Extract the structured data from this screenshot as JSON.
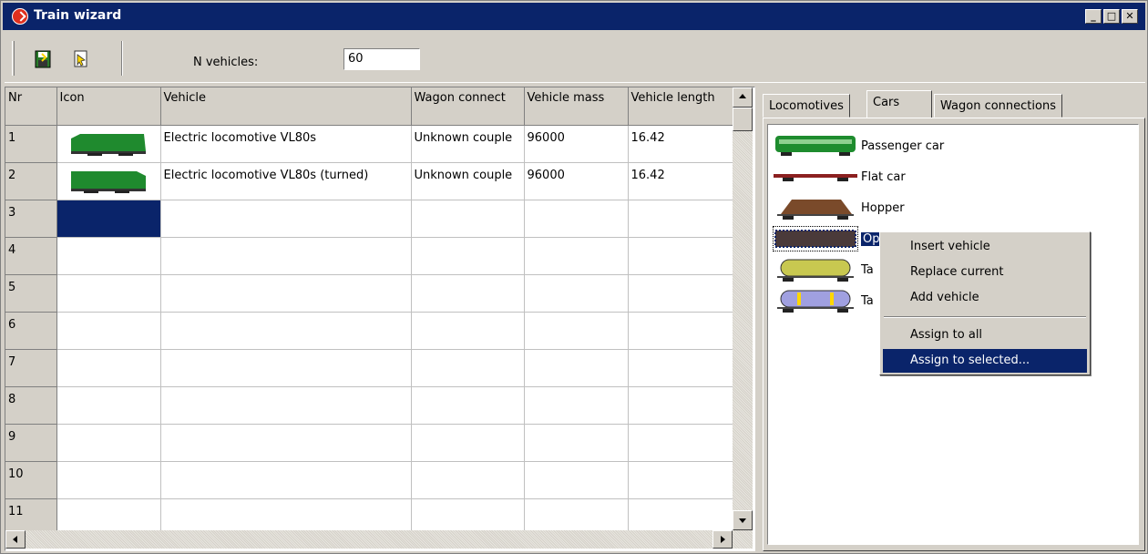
{
  "window": {
    "title": "Train wizard",
    "controls": [
      "_",
      "□",
      "✕"
    ]
  },
  "toolbar": {
    "save_icon": "save-icon",
    "select_icon": "select-icon",
    "n_vehicles_label": "N vehicles:",
    "n_vehicles_value": "60"
  },
  "grid": {
    "headers": [
      "Nr",
      "Icon",
      "Vehicle",
      "Wagon connect",
      "Vehicle mass",
      "Vehicle length"
    ],
    "rows": [
      {
        "nr": "1",
        "vehicle": "Electric locomotive VL80s",
        "connection": "Unknown couple",
        "mass": "96000",
        "length": "16.42"
      },
      {
        "nr": "2",
        "vehicle": "Electric locomotive VL80s (turned)",
        "connection": "Unknown couple",
        "mass": "96000",
        "length": "16.42"
      },
      {
        "nr": "3",
        "vehicle": "",
        "connection": "",
        "mass": "",
        "length": ""
      },
      {
        "nr": "4",
        "vehicle": "",
        "connection": "",
        "mass": "",
        "length": ""
      },
      {
        "nr": "5",
        "vehicle": "",
        "connection": "",
        "mass": "",
        "length": ""
      },
      {
        "nr": "6",
        "vehicle": "",
        "connection": "",
        "mass": "",
        "length": ""
      },
      {
        "nr": "7",
        "vehicle": "",
        "connection": "",
        "mass": "",
        "length": ""
      },
      {
        "nr": "8",
        "vehicle": "",
        "connection": "",
        "mass": "",
        "length": ""
      },
      {
        "nr": "9",
        "vehicle": "",
        "connection": "",
        "mass": "",
        "length": ""
      },
      {
        "nr": "10",
        "vehicle": "",
        "connection": "",
        "mass": "",
        "length": ""
      },
      {
        "nr": "11",
        "vehicle": "",
        "connection": "",
        "mass": "",
        "length": ""
      }
    ]
  },
  "tabs": [
    "Locomotives",
    "Cars",
    "Wagon connections"
  ],
  "active_tab": "Cars",
  "cars": [
    {
      "label": "Passenger car",
      "color": "#1e8c2e"
    },
    {
      "label": "Flat car",
      "color": "#8b2020"
    },
    {
      "label": "Hopper",
      "color": "#7a4a2a"
    },
    {
      "label": "Op",
      "color": "#5a3030"
    },
    {
      "label": "Ta",
      "color": "#c8c850"
    },
    {
      "label": "Ta",
      "color": "#a0a0e0"
    }
  ],
  "context_menu": {
    "items": [
      "Insert vehicle",
      "Replace current",
      "Add vehicle"
    ],
    "items2": [
      "Assign to all",
      "Assign to selected..."
    ]
  },
  "colors": {
    "title_bg": "#0a246a",
    "face": "#d4d0c8",
    "selection": "#0a246a",
    "loco_green": "#1f8a2e"
  }
}
